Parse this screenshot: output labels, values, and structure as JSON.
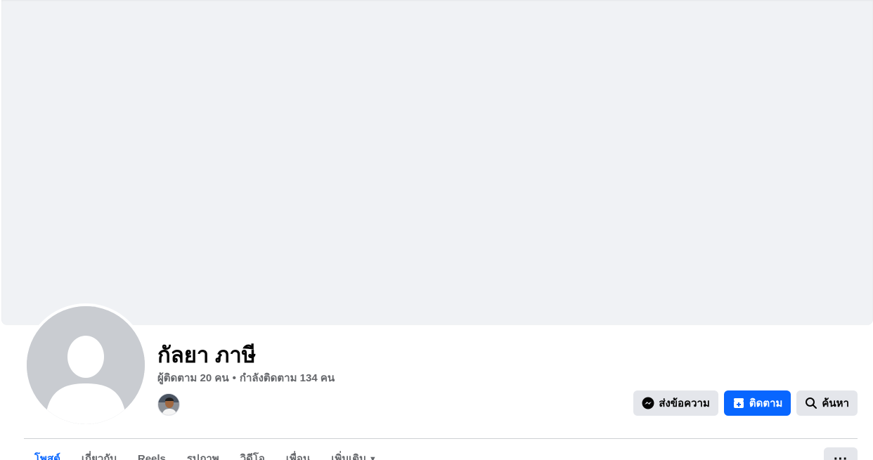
{
  "profile": {
    "name": "กัลยา ภาษี",
    "followers_text": "ผู้ติดตาม 20 คน",
    "separator": "•",
    "following_text": "กำลังติดตาม 134 คน"
  },
  "actions": {
    "message_label": "ส่งข้อความ",
    "follow_label": "ติดตาม",
    "search_label": "ค้นหา"
  },
  "tabs": [
    {
      "label": "โพสต์"
    },
    {
      "label": "เกี่ยวกับ"
    },
    {
      "label": "Reels"
    },
    {
      "label": "รูปภาพ"
    },
    {
      "label": "วิดีโอ"
    },
    {
      "label": "เพื่อน"
    },
    {
      "label": "เพิ่มเติม"
    }
  ],
  "more_options_glyph": "···",
  "colors": {
    "accent": "#0866ff",
    "cover": "#f0f2f5",
    "button_gray": "#e4e6eb",
    "secondary_text": "#65676b"
  },
  "icons": {
    "message": "messenger-icon",
    "follow": "follow-add-icon",
    "search": "search-icon",
    "tab_more": "caret-down-icon"
  }
}
